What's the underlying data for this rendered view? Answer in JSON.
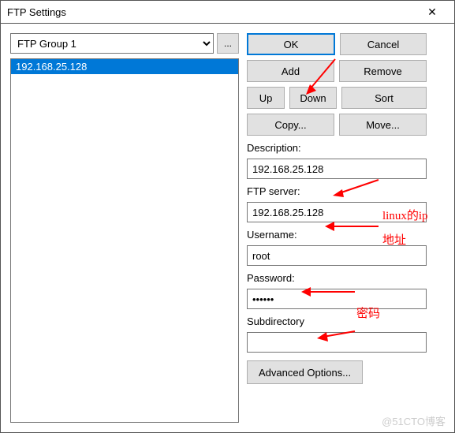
{
  "titlebar": {
    "title": "FTP Settings"
  },
  "group": {
    "selected": "FTP Group 1",
    "browse": "..."
  },
  "list": {
    "items": [
      "192.168.25.128"
    ]
  },
  "buttons": {
    "ok": "OK",
    "cancel": "Cancel",
    "add": "Add",
    "remove": "Remove",
    "up": "Up",
    "down": "Down",
    "sort": "Sort",
    "copy": "Copy...",
    "move": "Move...",
    "advanced": "Advanced Options..."
  },
  "fields": {
    "description_label": "Description:",
    "description": "192.168.25.128",
    "server_label": "FTP server:",
    "server": "192.168.25.128",
    "username_label": "Username:",
    "username": "root",
    "password_label": "Password:",
    "password": "••••••",
    "subdir_label": "Subdirectory",
    "subdir": ""
  },
  "annotations": {
    "linux_ip": "linux的ip",
    "address": "地址",
    "password": "密码"
  },
  "watermark": "@51CTO博客"
}
